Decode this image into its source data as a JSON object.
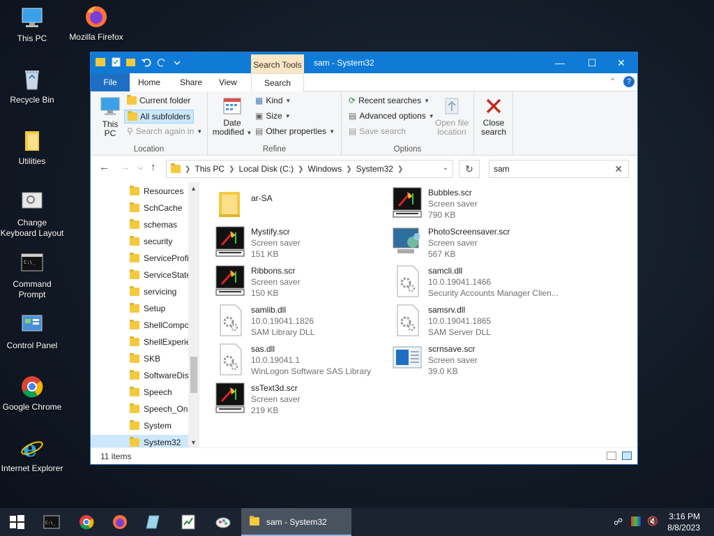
{
  "desktop": {
    "icons": [
      {
        "label": "This PC"
      },
      {
        "label": "Mozilla Firefox"
      },
      {
        "label": "Recycle Bin"
      },
      {
        "label": "Utilities"
      },
      {
        "label": "Change Keyboard Layout"
      },
      {
        "label": "Command Prompt"
      },
      {
        "label": "Control Panel"
      },
      {
        "label": "Google Chrome"
      },
      {
        "label": "Internet Explorer"
      }
    ]
  },
  "window": {
    "title": "sam - System32",
    "context_tab": "Search Tools",
    "tabs": {
      "file": "File",
      "home": "Home",
      "share": "Share",
      "view": "View",
      "search": "Search"
    },
    "ribbon": {
      "location": {
        "label": "Location",
        "this_pc": "This PC",
        "current_folder": "Current folder",
        "all_subfolders": "All subfolders",
        "search_again_in": "Search again in"
      },
      "refine": {
        "label": "Refine",
        "date_modified": "Date modified",
        "kind": "Kind",
        "size": "Size",
        "other_properties": "Other properties"
      },
      "options": {
        "label": "Options",
        "recent_searches": "Recent searches",
        "advanced_options": "Advanced options",
        "save_search": "Save search",
        "open_file_location": "Open file location"
      },
      "close_search": "Close search"
    },
    "address": {
      "crumbs": [
        "This PC",
        "Local Disk (C:)",
        "Windows",
        "System32"
      ]
    },
    "search": {
      "value": "sam"
    },
    "nav_items": [
      {
        "label": "Resources"
      },
      {
        "label": "SchCache"
      },
      {
        "label": "schemas"
      },
      {
        "label": "security"
      },
      {
        "label": "ServiceProfi"
      },
      {
        "label": "ServiceState"
      },
      {
        "label": "servicing"
      },
      {
        "label": "Setup"
      },
      {
        "label": "ShellCompo"
      },
      {
        "label": "ShellExperie"
      },
      {
        "label": "SKB"
      },
      {
        "label": "SoftwareDis"
      },
      {
        "label": "Speech"
      },
      {
        "label": "Speech_One"
      },
      {
        "label": "System"
      },
      {
        "label": "System32"
      }
    ],
    "files": [
      {
        "name": "ar-SA",
        "line2": "",
        "line3": "",
        "icon": "folder-icon"
      },
      {
        "name": "Bubbles.scr",
        "line2": "Screen saver",
        "line3": "790 KB",
        "icon": "screensaver-icon"
      },
      {
        "name": "Mystify.scr",
        "line2": "Screen saver",
        "line3": "151 KB",
        "icon": "screensaver-icon"
      },
      {
        "name": "PhotoScreensaver.scr",
        "line2": "Screen saver",
        "line3": "567 KB",
        "icon": "photo-screensaver-icon"
      },
      {
        "name": "Ribbons.scr",
        "line2": "Screen saver",
        "line3": "150 KB",
        "icon": "screensaver-icon"
      },
      {
        "name": "samcli.dll",
        "line2": "10.0.19041.1466",
        "line3": "Security Accounts Manager Clien...",
        "icon": "dll-gear-icon"
      },
      {
        "name": "samlib.dll",
        "line2": "10.0.19041.1826",
        "line3": "SAM Library DLL",
        "icon": "dll-gear-icon"
      },
      {
        "name": "samsrv.dll",
        "line2": "10.0.19041.1865",
        "line3": "SAM Server DLL",
        "icon": "dll-gear-icon"
      },
      {
        "name": "sas.dll",
        "line2": "10.0.19041.1",
        "line3": "WinLogon Software SAS Library",
        "icon": "dll-gear-icon"
      },
      {
        "name": "scrnsave.scr",
        "line2": "Screen saver",
        "line3": "39.0 KB",
        "icon": "blank-screensaver-icon"
      },
      {
        "name": "ssText3d.scr",
        "line2": "Screen saver",
        "line3": "219 KB",
        "icon": "screensaver-icon"
      }
    ],
    "status": {
      "count": "11 items"
    }
  },
  "taskbar": {
    "active_label": "sam - System32",
    "time": "3:16 PM",
    "date": "8/8/2023"
  },
  "colors": {
    "titlebar": "#0f7bd6",
    "selection": "#cce8ff",
    "context_tab": "#fbe6c4",
    "close_search": "#c42b1c"
  }
}
